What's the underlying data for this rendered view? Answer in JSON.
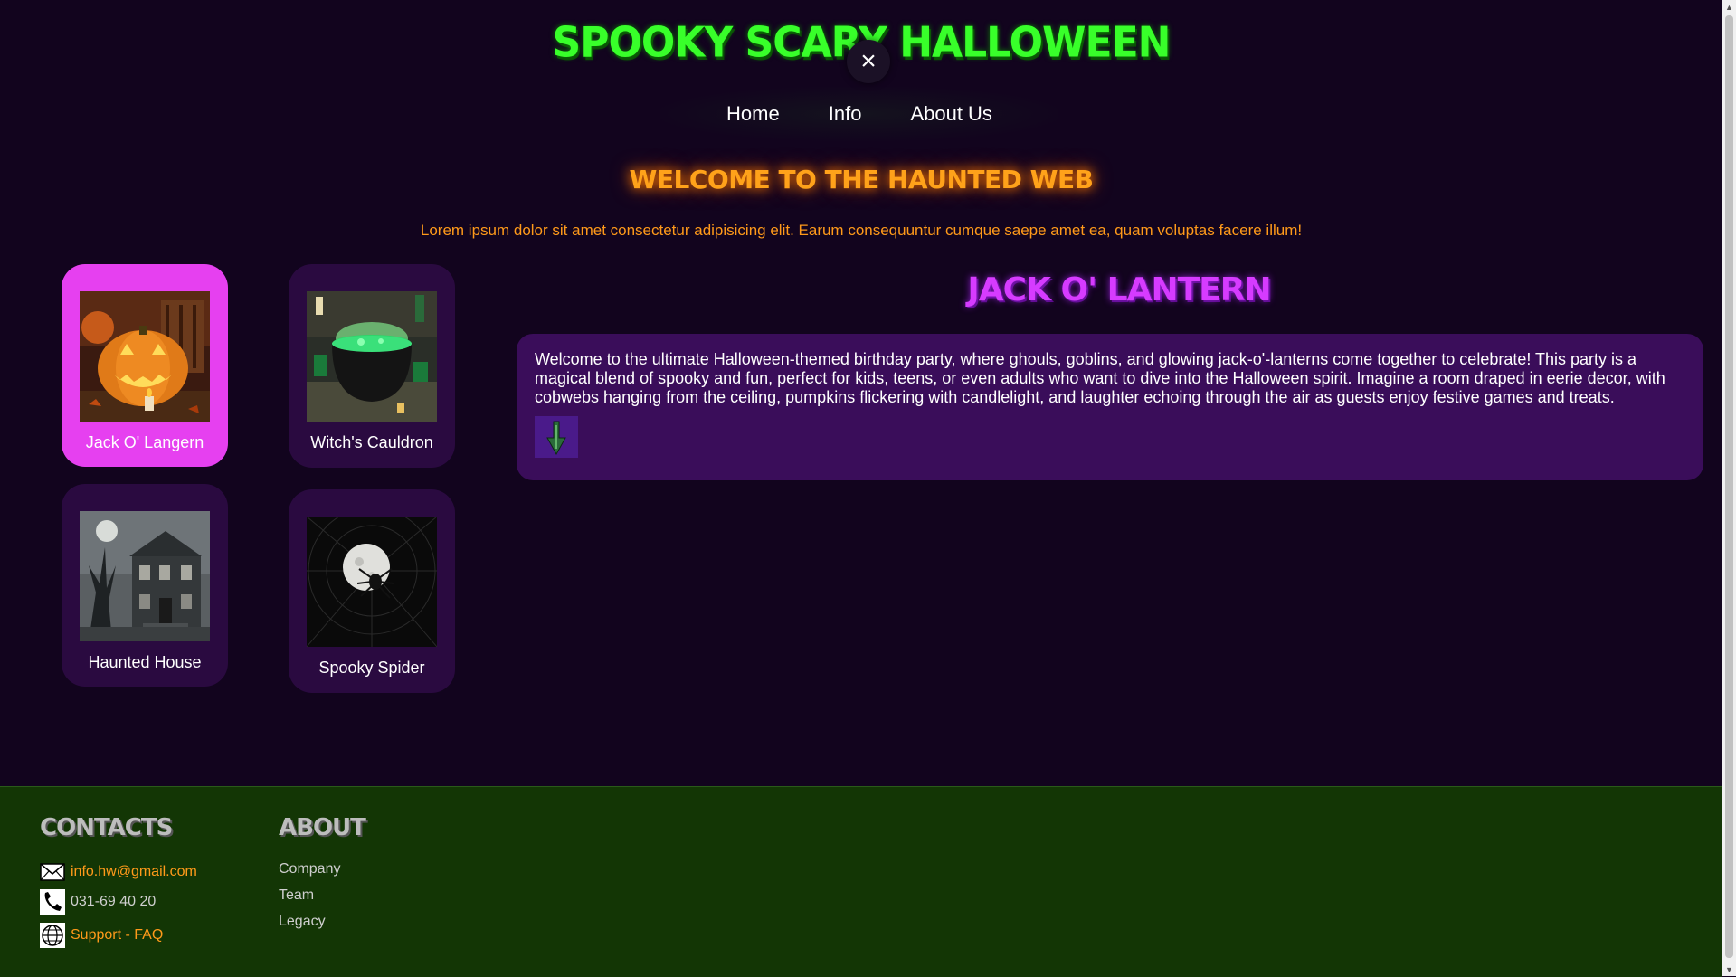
{
  "header": {
    "title": "Spooky Scary Halloween",
    "close_symbol": "×",
    "nav": [
      "Home",
      "Info",
      "About Us"
    ]
  },
  "hero": {
    "welcome": "Welcome to the Haunted Web",
    "lead": "Lorem ipsum dolor sit amet consectetur adipisicing elit. Earum consequuntur cumque saepe amet ea, quam voluptas facere illum!"
  },
  "cards": [
    {
      "label": "Jack O' Langern",
      "icon": "pumpkin-image",
      "active": true
    },
    {
      "label": "Witch's Cauldron",
      "icon": "cauldron-image",
      "active": false
    },
    {
      "label": "Haunted House",
      "icon": "haunted-house-image",
      "active": false
    },
    {
      "label": "Spooky Spider",
      "icon": "spider-moon-image",
      "active": false
    }
  ],
  "detail": {
    "title": "Jack O' Lantern",
    "text": "Welcome to the ultimate Halloween-themed birthday party, where ghouls, goblins, and glowing jack-o'-lanterns come together to celebrate! This party is a magical blend of spooky and fun, perfect for kids, teens, or even adults who want to dive into the Halloween spirit. Imagine a room draped in eerie decor, with cobwebs hanging from the ceiling, pumpkins flickering with candlelight, and laughter echoing through the air as guests enjoy festive games and treats.",
    "icon": "down-arrow-icon"
  },
  "footer": {
    "contacts_heading": "Contacts",
    "about_heading": "About",
    "email": "info.hw@gmail.com",
    "phone": "031-69 40 20",
    "support": "Support - FAQ",
    "about_links": [
      "Company",
      "Team",
      "Legacy"
    ]
  },
  "colors": {
    "background": "#12041e",
    "title_green": "#38ff2a",
    "orange": "#ffa21a",
    "purple_accent": "#d63bff",
    "active_card": "#e640f0",
    "card": "#2a0a40",
    "panel": "#3a0d5a",
    "footer": "#133605"
  }
}
